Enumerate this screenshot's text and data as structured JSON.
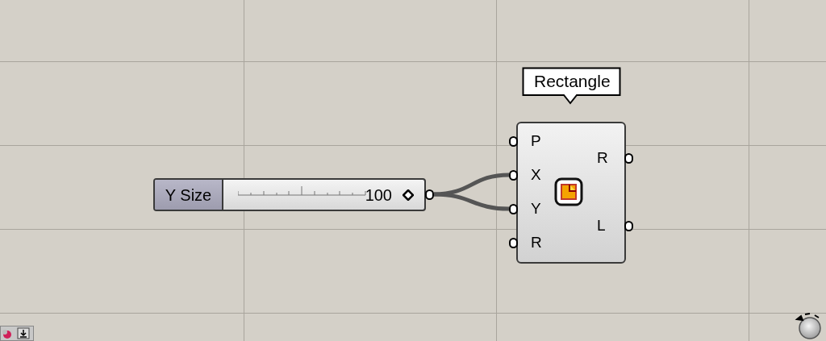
{
  "slider": {
    "label": "Y Size",
    "value": "100"
  },
  "component": {
    "tooltip": "Rectangle",
    "inputs": [
      {
        "label": "P",
        "wired": false
      },
      {
        "label": "X",
        "wired": true
      },
      {
        "label": "Y",
        "wired": true
      },
      {
        "label": "R",
        "wired": false
      }
    ],
    "outputs": [
      {
        "label": "R"
      },
      {
        "label": "L"
      }
    ]
  }
}
